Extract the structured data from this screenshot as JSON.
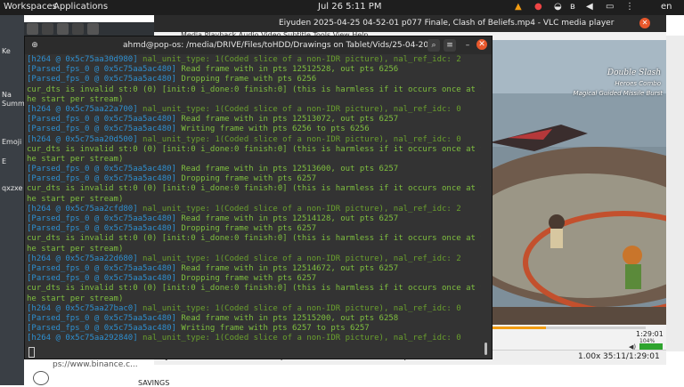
{
  "topbar": {
    "workspaces": "Workspaces",
    "applications": "Applications",
    "datetime": "Jul 26  5:11 PM",
    "lang": "en"
  },
  "desktop": {
    "labels": [
      "Ke",
      "Na",
      "Summ",
      "Emoji",
      "E",
      "qxzxe"
    ]
  },
  "vlc": {
    "title": "Eiyuden 2025-04-25 04-52-01 p077 Finale, Clash of Beliefs.mp4 - VLC media player",
    "menu": "Media  Playback  Audio  Video  Subtitle  Tools  View  Help",
    "overlay_line1": "Double Slash",
    "overlay_line2": "Heroes Combo",
    "overlay_line3": "Magical Guided Missile Burst",
    "time": "1:29:01",
    "volume": "104%",
    "status_title": "Eiyuden 2025-04-25 04-52-01 p077 Finale, Clash of Beliefs.mp4",
    "speed": "1.00x",
    "position": "35:11/1:29:01"
  },
  "browser": {
    "url_text": "ps://www.binance.c...",
    "savings": "SAVINGS"
  },
  "terminal": {
    "title": "ahmd@pop-os: /media/DRIVE/Files/toHDD/Drawings on Tablet/Vids/25-04-2025",
    "lines": [
      {
        "a": "[h264 @ 0x5c75aa30d980] ",
        "b": "nal_unit_type: 1(Coded slice of a non-IDR picture), nal_ref_idc: 2"
      },
      {
        "a": "[Parsed_fps_0 @ 0x5c75aa5ac480] ",
        "b": "Read frame with in pts 12512528, out pts 6256"
      },
      {
        "a": "[Parsed_fps_0 @ 0x5c75aa5ac480] ",
        "b": "Dropping frame with pts 6256"
      },
      {
        "a": "",
        "b": "cur_dts is invalid st:0 (0) [init:0 i_done:0 finish:0] (this is harmless if it occurs once at t"
      },
      {
        "a": "",
        "b": "he start per stream)"
      },
      {
        "a": "[h264 @ 0x5c75aa22a700] ",
        "b": "nal_unit_type: 1(Coded slice of a non-IDR picture), nal_ref_idc: 0"
      },
      {
        "a": "[Parsed_fps_0 @ 0x5c75aa5ac480] ",
        "b": "Read frame with in pts 12513072, out pts 6257"
      },
      {
        "a": "[Parsed_fps_0 @ 0x5c75aa5ac480] ",
        "b": "Writing frame with pts 6256 to pts 6256"
      },
      {
        "a": "[h264 @ 0x5c75aa20d500] ",
        "b": "nal_unit_type: 1(Coded slice of a non-IDR picture), nal_ref_idc: 0"
      },
      {
        "a": "",
        "b": "cur_dts is invalid st:0 (0) [init:0 i_done:0 finish:0] (this is harmless if it occurs once at t"
      },
      {
        "a": "",
        "b": "he start per stream)"
      },
      {
        "a": "[Parsed_fps_0 @ 0x5c75aa5ac480] ",
        "b": "Read frame with in pts 12513600, out pts 6257"
      },
      {
        "a": "[Parsed_fps_0 @ 0x5c75aa5ac480] ",
        "b": "Dropping frame with pts 6257"
      },
      {
        "a": "",
        "b": "cur_dts is invalid st:0 (0) [init:0 i_done:0 finish:0] (this is harmless if it occurs once at t"
      },
      {
        "a": "",
        "b": "he start per stream)"
      },
      {
        "a": "[h264 @ 0x5c75aa2cfd80] ",
        "b": "nal_unit_type: 1(Coded slice of a non-IDR picture), nal_ref_idc: 2"
      },
      {
        "a": "[Parsed_fps_0 @ 0x5c75aa5ac480] ",
        "b": "Read frame with in pts 12514128, out pts 6257"
      },
      {
        "a": "[Parsed_fps_0 @ 0x5c75aa5ac480] ",
        "b": "Dropping frame with pts 6257"
      },
      {
        "a": "",
        "b": "cur_dts is invalid st:0 (0) [init:0 i_done:0 finish:0] (this is harmless if it occurs once at t"
      },
      {
        "a": "",
        "b": "he start per stream)"
      },
      {
        "a": "[h264 @ 0x5c75aa22d680] ",
        "b": "nal_unit_type: 1(Coded slice of a non-IDR picture), nal_ref_idc: 2"
      },
      {
        "a": "[Parsed_fps_0 @ 0x5c75aa5ac480] ",
        "b": "Read frame with in pts 12514672, out pts 6257"
      },
      {
        "a": "[Parsed_fps_0 @ 0x5c75aa5ac480] ",
        "b": "Dropping frame with pts 6257"
      },
      {
        "a": "",
        "b": "cur_dts is invalid st:0 (0) [init:0 i_done:0 finish:0] (this is harmless if it occurs once at t"
      },
      {
        "a": "",
        "b": "he start per stream)"
      },
      {
        "a": "[h264 @ 0x5c75aa27bac0] ",
        "b": "nal_unit_type: 1(Coded slice of a non-IDR picture), nal_ref_idc: 0"
      },
      {
        "a": "[Parsed_fps_0 @ 0x5c75aa5ac480] ",
        "b": "Read frame with in pts 12515200, out pts 6258"
      },
      {
        "a": "[Parsed_fps_0 @ 0x5c75aa5ac480] ",
        "b": "Writing frame with pts 6257 to pts 6257"
      },
      {
        "a": "[h264 @ 0x5c75aa292840] ",
        "b": "nal_unit_type: 1(Coded slice of a non-IDR picture), nal_ref_idc: 0"
      }
    ]
  },
  "colors": {
    "terminal_bg": "#333333",
    "log_prefix": "#2e8fd0",
    "log_text": "#7fbf3f",
    "vlc_accent": "#f39c12",
    "close_button": "#e8582c"
  }
}
